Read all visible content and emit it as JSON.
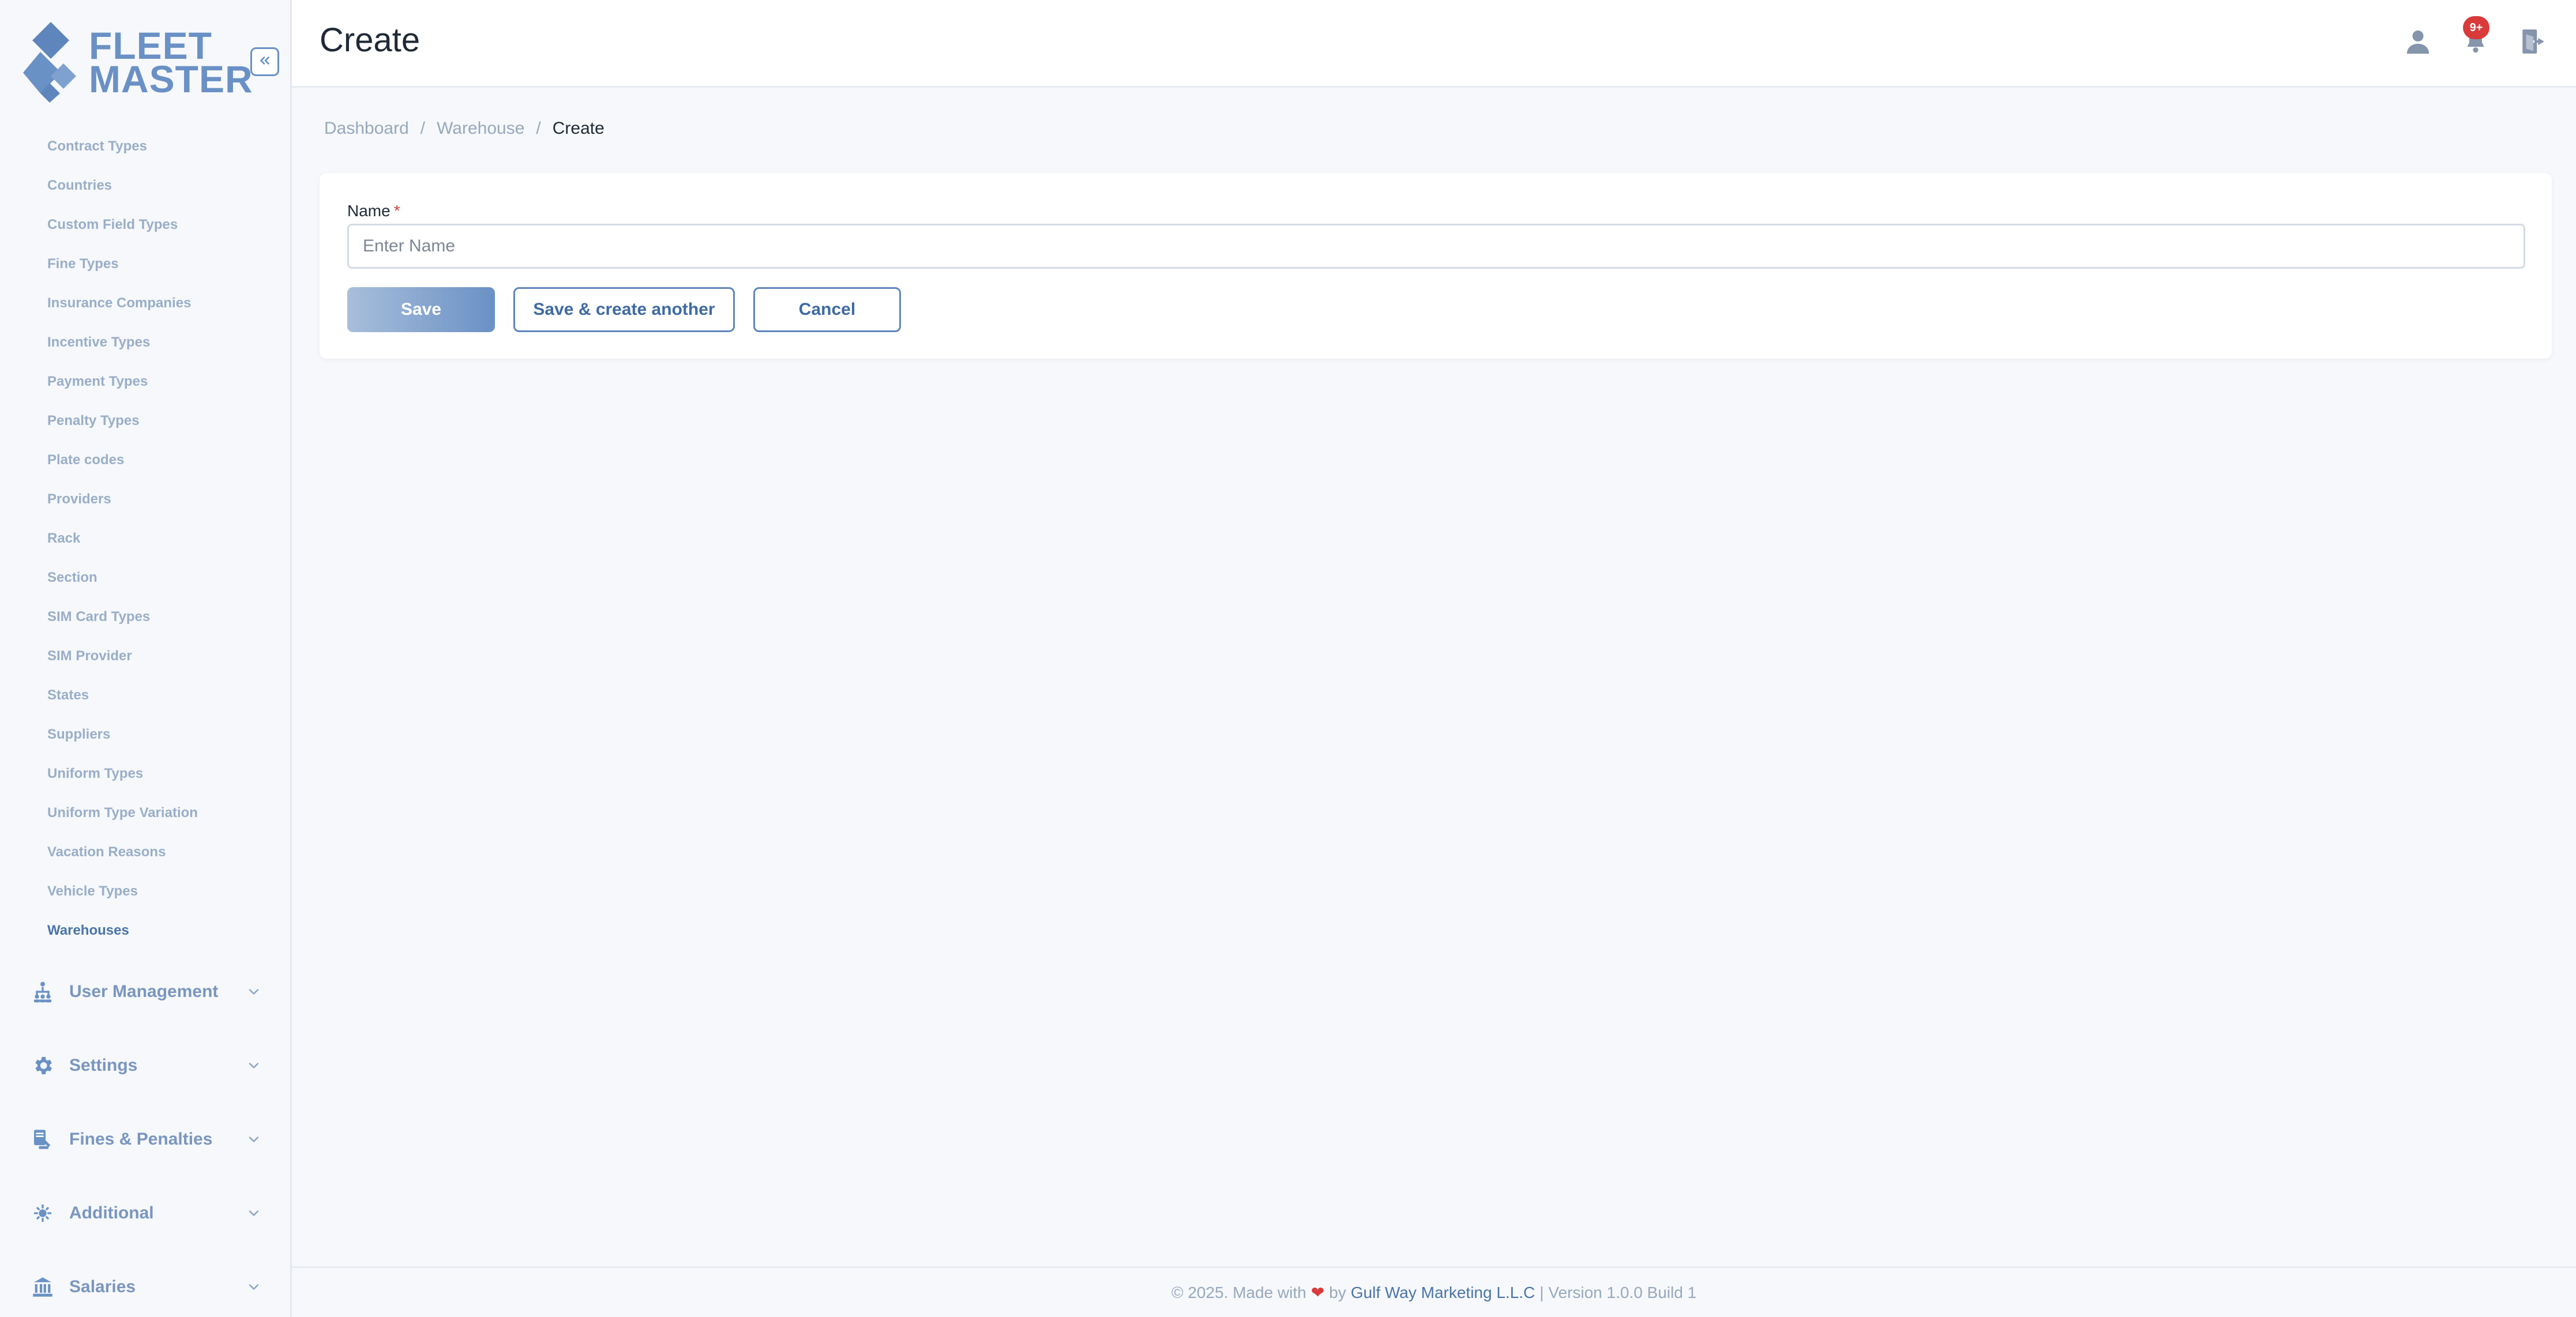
{
  "app": {
    "logo_line1": "FLEET",
    "logo_line2": "MASTER"
  },
  "sidebar": {
    "submenu": [
      {
        "label": "Contract Types"
      },
      {
        "label": "Countries"
      },
      {
        "label": "Custom Field Types"
      },
      {
        "label": "Fine Types"
      },
      {
        "label": "Insurance Companies"
      },
      {
        "label": "Incentive Types"
      },
      {
        "label": "Payment Types"
      },
      {
        "label": "Penalty Types"
      },
      {
        "label": "Plate codes"
      },
      {
        "label": "Providers"
      },
      {
        "label": "Rack"
      },
      {
        "label": "Section"
      },
      {
        "label": "SIM Card Types"
      },
      {
        "label": "SIM Provider"
      },
      {
        "label": "States"
      },
      {
        "label": "Suppliers"
      },
      {
        "label": "Uniform Types"
      },
      {
        "label": "Uniform Type Variation"
      },
      {
        "label": "Vacation Reasons"
      },
      {
        "label": "Vehicle Types"
      },
      {
        "label": "Warehouses",
        "active": true
      }
    ],
    "groups": [
      {
        "label": "User Management",
        "icon": "hierarchy-icon"
      },
      {
        "label": "Settings",
        "icon": "gear-icon"
      },
      {
        "label": "Fines & Penalties",
        "icon": "fines-icon"
      },
      {
        "label": "Additional",
        "icon": "additional-icon"
      },
      {
        "label": "Salaries",
        "icon": "salaries-icon"
      }
    ]
  },
  "header": {
    "title": "Create",
    "notification_badge": "9+"
  },
  "breadcrumb": {
    "items": [
      "Dashboard",
      "Warehouse"
    ],
    "current": "Create",
    "separator": "/"
  },
  "form": {
    "name_label": "Name",
    "required_mark": "*",
    "name_placeholder": "Enter Name",
    "name_value": ""
  },
  "buttons": {
    "save": "Save",
    "save_another": "Save & create another",
    "cancel": "Cancel"
  },
  "footer": {
    "prefix": "© 2025. Made with",
    "heart": "❤",
    "by": "by",
    "company": "Gulf Way Marketing L.L.C",
    "suffix": "| Version 1.0.0 Build 1"
  },
  "colors": {
    "brand": "#6a91c5",
    "badge": "#d93a3a",
    "required": "#e03b3b"
  }
}
